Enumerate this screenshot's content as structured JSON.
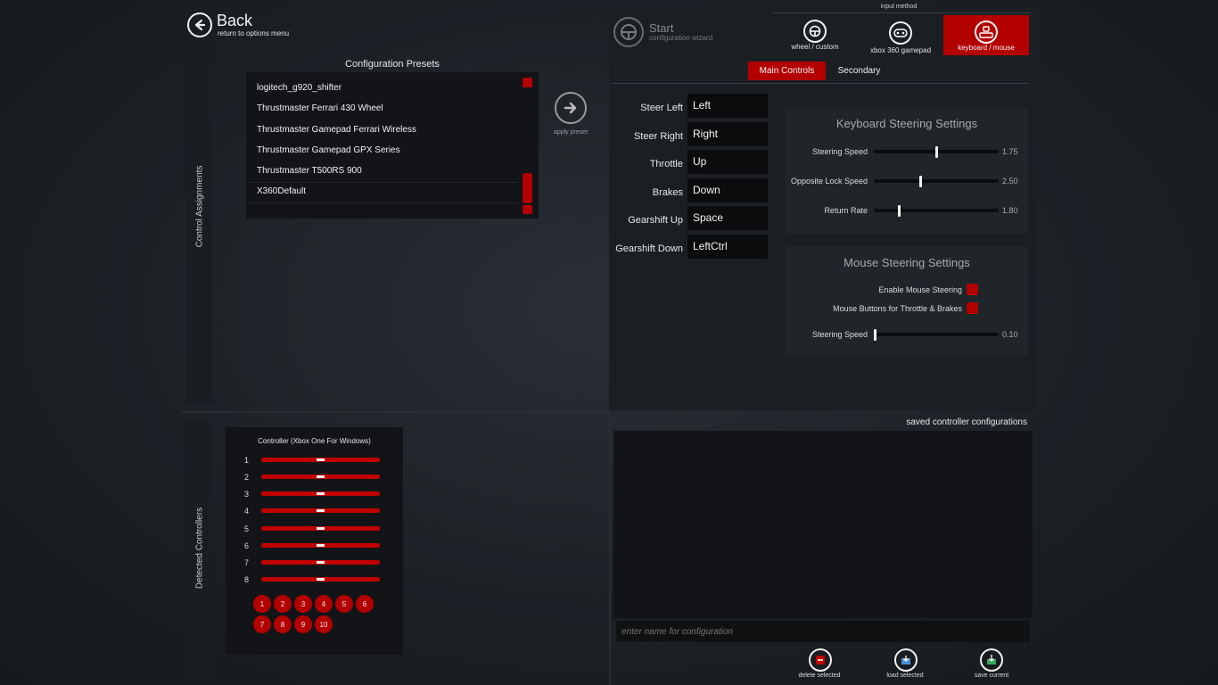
{
  "header": {
    "back_title": "Back",
    "back_subtitle": "return to options menu",
    "start_title": "Start",
    "start_subtitle": "configuration wizard",
    "input_method_label": "input method",
    "input_methods": [
      {
        "label": "wheel / custom",
        "icon": "wheel-icon",
        "active": false
      },
      {
        "label": "xbox 360 gamepad",
        "icon": "gamepad-icon",
        "active": false
      },
      {
        "label": "keyboard / mouse",
        "icon": "keyboard-mouse-icon",
        "active": true
      }
    ]
  },
  "side_labels": {
    "control_assignments": "Control Assignments",
    "detected_controllers": "Detected Controllers"
  },
  "presets": {
    "title": "Configuration Presets",
    "items": [
      "logitech_g920_shifter",
      "Thrustmaster Ferrari 430 Wheel",
      "Thrustmaster Gamepad Ferrari Wireless",
      "Thrustmaster Gamepad GPX Series",
      "Thrustmaster T500RS 900",
      "X360Default"
    ],
    "apply_label": "apply preset"
  },
  "tabs": {
    "main": "Main Controls",
    "secondary": "Secondary"
  },
  "controls": [
    {
      "label": "Steer Left",
      "value": "Left"
    },
    {
      "label": "Steer Right",
      "value": "Right"
    },
    {
      "label": "Throttle",
      "value": "Up"
    },
    {
      "label": "Brakes",
      "value": "Down"
    },
    {
      "label": "Gearshift Up",
      "value": "Space"
    },
    {
      "label": "Gearshift Down",
      "value": "LeftCtrl"
    }
  ],
  "keyboard_settings": {
    "title": "Keyboard Steering Settings",
    "sliders": [
      {
        "label": "Steering Speed",
        "value": "1.75",
        "fraction": 0.5
      },
      {
        "label": "Opposite Lock Speed",
        "value": "2.50",
        "fraction": 0.37
      },
      {
        "label": "Return Rate",
        "value": "1.80",
        "fraction": 0.2
      }
    ]
  },
  "mouse_settings": {
    "title": "Mouse Steering Settings",
    "checks": [
      {
        "label": "Enable Mouse Steering"
      },
      {
        "label": "Mouse Buttons for Throttle & Brakes"
      }
    ],
    "slider": {
      "label": "Steering Speed",
      "value": "0.10",
      "fraction": 0.0
    }
  },
  "controller": {
    "title": "Controller (Xbox One For Windows)",
    "axes": [
      "1",
      "2",
      "3",
      "4",
      "5",
      "6",
      "7",
      "8"
    ],
    "buttons": [
      "1",
      "2",
      "3",
      "4",
      "5",
      "6",
      "7",
      "8",
      "9",
      "10"
    ]
  },
  "saved": {
    "title": "saved controller configurations",
    "placeholder": "enter name for configuration",
    "actions": [
      {
        "label": "delete selected",
        "icon": "delete-icon"
      },
      {
        "label": "load selected",
        "icon": "load-icon"
      },
      {
        "label": "save current",
        "icon": "save-icon"
      }
    ]
  },
  "colors": {
    "accent_red": "#b30000",
    "panel": "#1c2025",
    "field": "#0b0c0e"
  }
}
